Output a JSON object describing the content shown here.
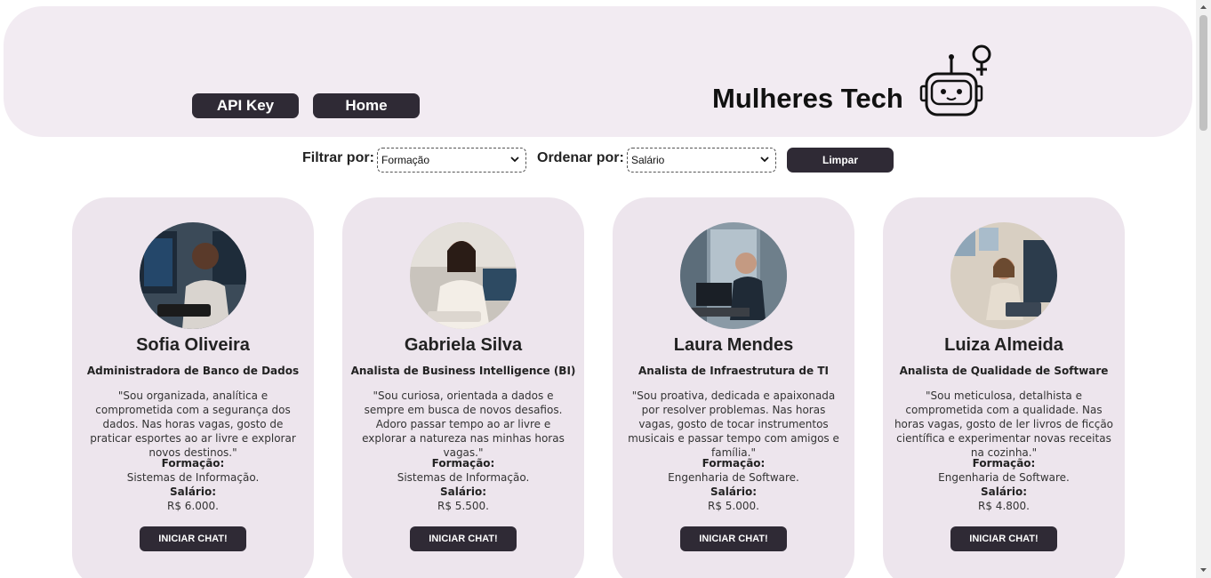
{
  "header": {
    "brand_title": "Mulheres Tech",
    "nav": [
      {
        "label": "API Key"
      },
      {
        "label": "Home"
      }
    ]
  },
  "filters": {
    "filter_label": "Filtrar por:",
    "filter_selected": "Formação",
    "order_label": "Ordenar por:",
    "order_selected": "Salário",
    "clear_label": "Limpar"
  },
  "cards": [
    {
      "name": "Sofia Oliveira",
      "role": "Administradora de Banco de Dados",
      "quote": "\"Sou organizada, analítica e comprometida com a segurança dos dados. Nas horas vagas, gosto de praticar esportes ao ar livre e explorar novos destinos.\"",
      "education_label": "Formação:",
      "education": "Sistemas de Informação.",
      "salary_label": "Salário:",
      "salary": "R$ 6.000.",
      "button": "INICIAR CHAT!"
    },
    {
      "name": "Gabriela Silva",
      "role": "Analista de Business Intelligence (BI)",
      "quote": "\"Sou curiosa, orientada a dados e sempre em busca de novos desafios. Adoro passar tempo ao ar livre e explorar a natureza nas minhas horas vagas.\"",
      "education_label": "Formação:",
      "education": "Sistemas de Informação.",
      "salary_label": "Salário:",
      "salary": "R$ 5.500.",
      "button": "INICIAR CHAT!"
    },
    {
      "name": "Laura Mendes",
      "role": "Analista de Infraestrutura de TI",
      "quote": "\"Sou proativa, dedicada e apaixonada por resolver problemas. Nas horas vagas, gosto de tocar instrumentos musicais e passar tempo com amigos e família.\"",
      "education_label": "Formação:",
      "education": "Engenharia de Software.",
      "salary_label": "Salário:",
      "salary": "R$ 5.000.",
      "button": "INICIAR CHAT!"
    },
    {
      "name": "Luiza Almeida",
      "role": "Analista de Qualidade de Software",
      "quote": "\"Sou meticulosa, detalhista e comprometida com a qualidade. Nas horas vagas, gosto de ler livros de ficção científica e experimentar novas receitas na cozinha.\"",
      "education_label": "Formação:",
      "education": "Engenharia de Software.",
      "salary_label": "Salário:",
      "salary": "R$ 4.800.",
      "button": "INICIAR CHAT!"
    }
  ],
  "icons": {
    "logo": "robot-female-logo-icon",
    "select_arrow": "chevron-down-icon"
  },
  "colors": {
    "header_bg": "#f2ebf2",
    "card_bg": "#ede5ed",
    "button_bg": "#2f2a35"
  }
}
